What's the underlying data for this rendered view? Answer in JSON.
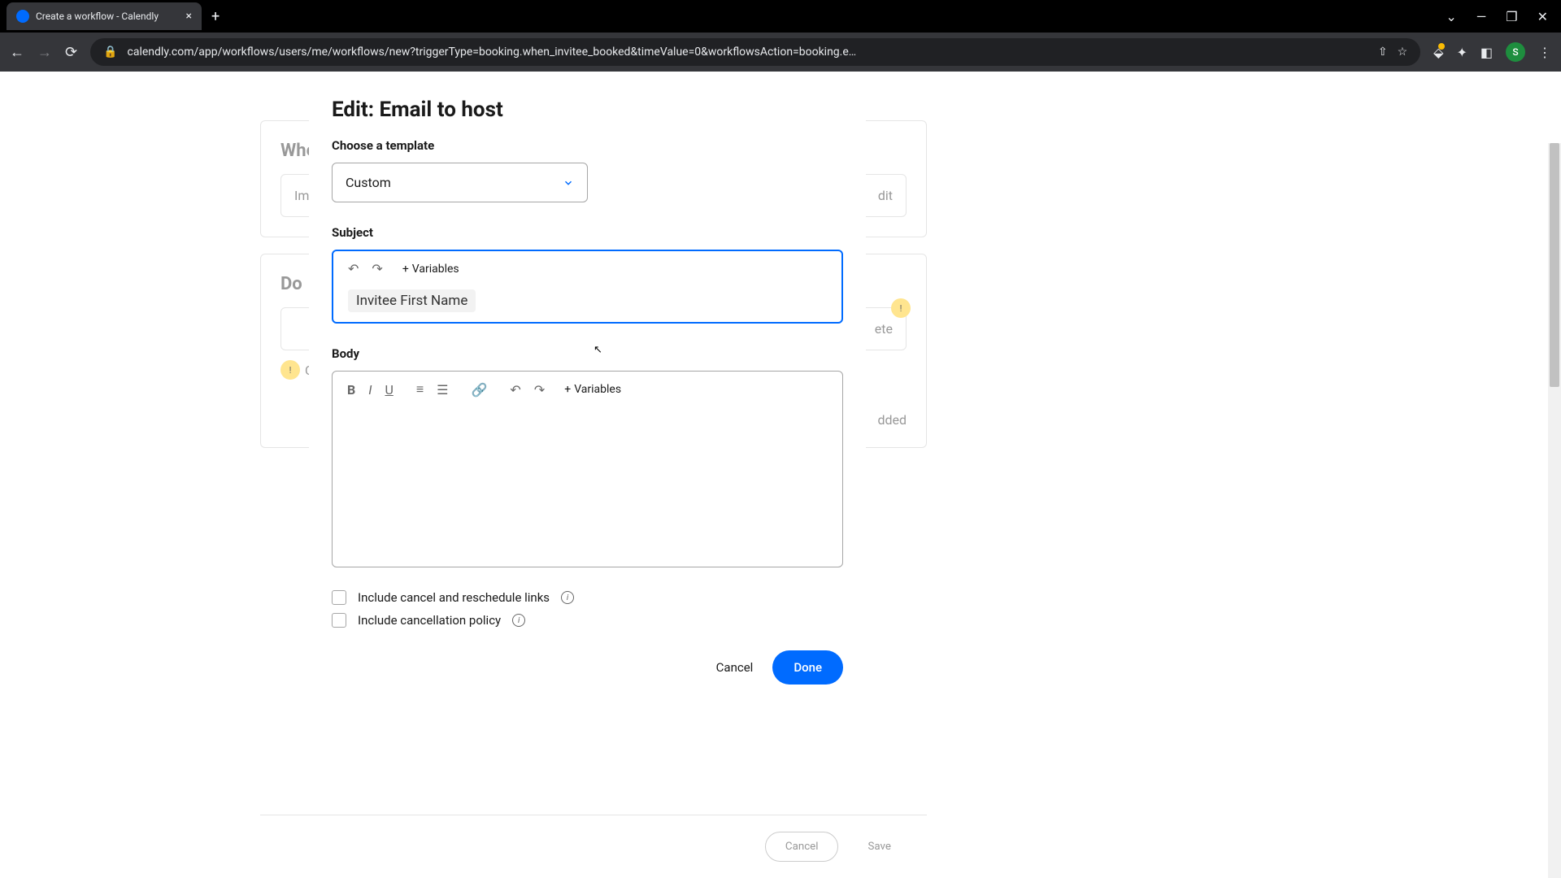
{
  "browser": {
    "tab_title": "Create a workflow - Calendly",
    "url": "calendly.com/app/workflows/users/me/workflows/new?triggerType=booking.when_invitee_booked&timeValue=0&workflowsAction=booking.e…",
    "avatar_initial": "S"
  },
  "background": {
    "when_heading": "Whe",
    "do_heading": "Do",
    "card1_text": "Im",
    "card1_edit": "dit",
    "card2_text": "ete",
    "card2_added": "dded",
    "cu_text": "Cu",
    "cancel": "Cancel",
    "save": "Save"
  },
  "modal": {
    "title": "Edit: Email to host",
    "template_label": "Choose a template",
    "template_value": "Custom",
    "subject_label": "Subject",
    "subject_variable_chip": "Invitee First Name",
    "variables_btn": "Variables",
    "body_label": "Body",
    "checkbox1": "Include cancel and reschedule links",
    "checkbox2": "Include cancellation policy",
    "cancel": "Cancel",
    "done": "Done"
  }
}
